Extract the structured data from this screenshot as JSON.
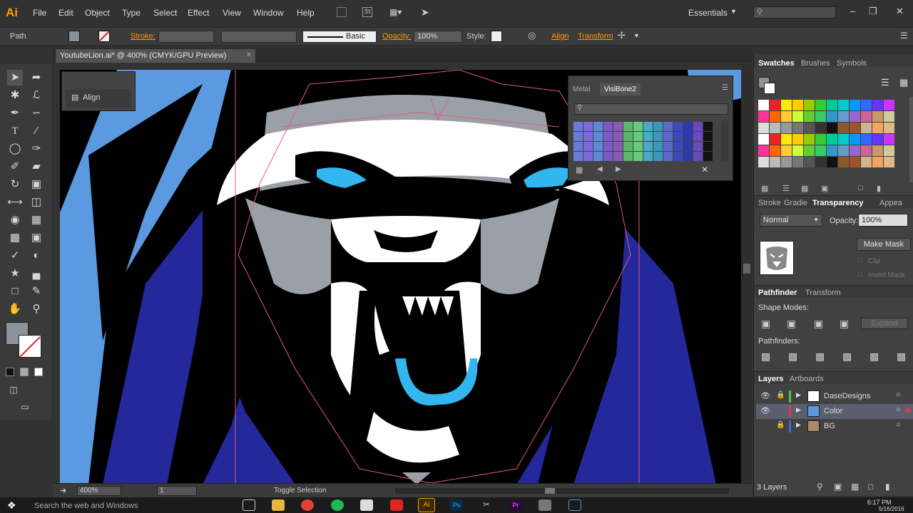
{
  "app": {
    "logo": "Ai"
  },
  "menu": [
    "File",
    "Edit",
    "Object",
    "Type",
    "Select",
    "Effect",
    "View",
    "Window",
    "Help"
  ],
  "workspace": "Essentials",
  "control_bar": {
    "selection": "Path",
    "stroke_label": "Stroke:",
    "brush_preset": "Basic",
    "opacity_label": "Opacity:",
    "opacity_value": "100%",
    "style_label": "Style:",
    "align_link": "Align",
    "transform_link": "Transform"
  },
  "document_tab": {
    "title": "YoutubeLion.ai* @ 400% (CMYK/GPU Preview)",
    "close_label": "×"
  },
  "align_panel": {
    "label": "Align"
  },
  "color_panel": {
    "tabs": [
      "Metal",
      "VisiBone2"
    ]
  },
  "right_panels": {
    "swatches_tabs": [
      "Swatches",
      "Brushes",
      "Symbols"
    ],
    "transparency_tabs": [
      "Stroke",
      "Gradie",
      "Transparency",
      "Appea"
    ],
    "blend_mode": "Normal",
    "opacity_label": "Opacity:",
    "opacity_value": "100%",
    "make_mask": "Make Mask",
    "clip": "Clip",
    "invert_mask": "Invert Mask",
    "pathfinder_tabs": [
      "Pathfinder",
      "Transform"
    ],
    "shape_modes": "Shape Modes:",
    "expand": "Expand",
    "pathfinders": "Pathfinders:",
    "layers_tabs": [
      "Layers",
      "Artboards"
    ],
    "layers": [
      {
        "name": "DaseDesigns",
        "color": "#3fd23f"
      },
      {
        "name": "Color",
        "color": "#e03b3b"
      },
      {
        "name": "BG",
        "color": "#3b6be0"
      }
    ],
    "layer_count": "3 Layers"
  },
  "status_bar": {
    "zoom": "400%",
    "artboard": "1",
    "tool": "Toggle Selection"
  },
  "taskbar": {
    "search_placeholder": "Search the web and Windows",
    "time": "6:17 PM",
    "date": "5/16/2016"
  },
  "colors": {
    "accent": "#ff9a00",
    "lion_blue": "#5b9ae0",
    "lion_dark_blue": "#2a2f9c",
    "eye_cyan": "#33b5f0",
    "mane_gray": "#9aa0a8"
  }
}
